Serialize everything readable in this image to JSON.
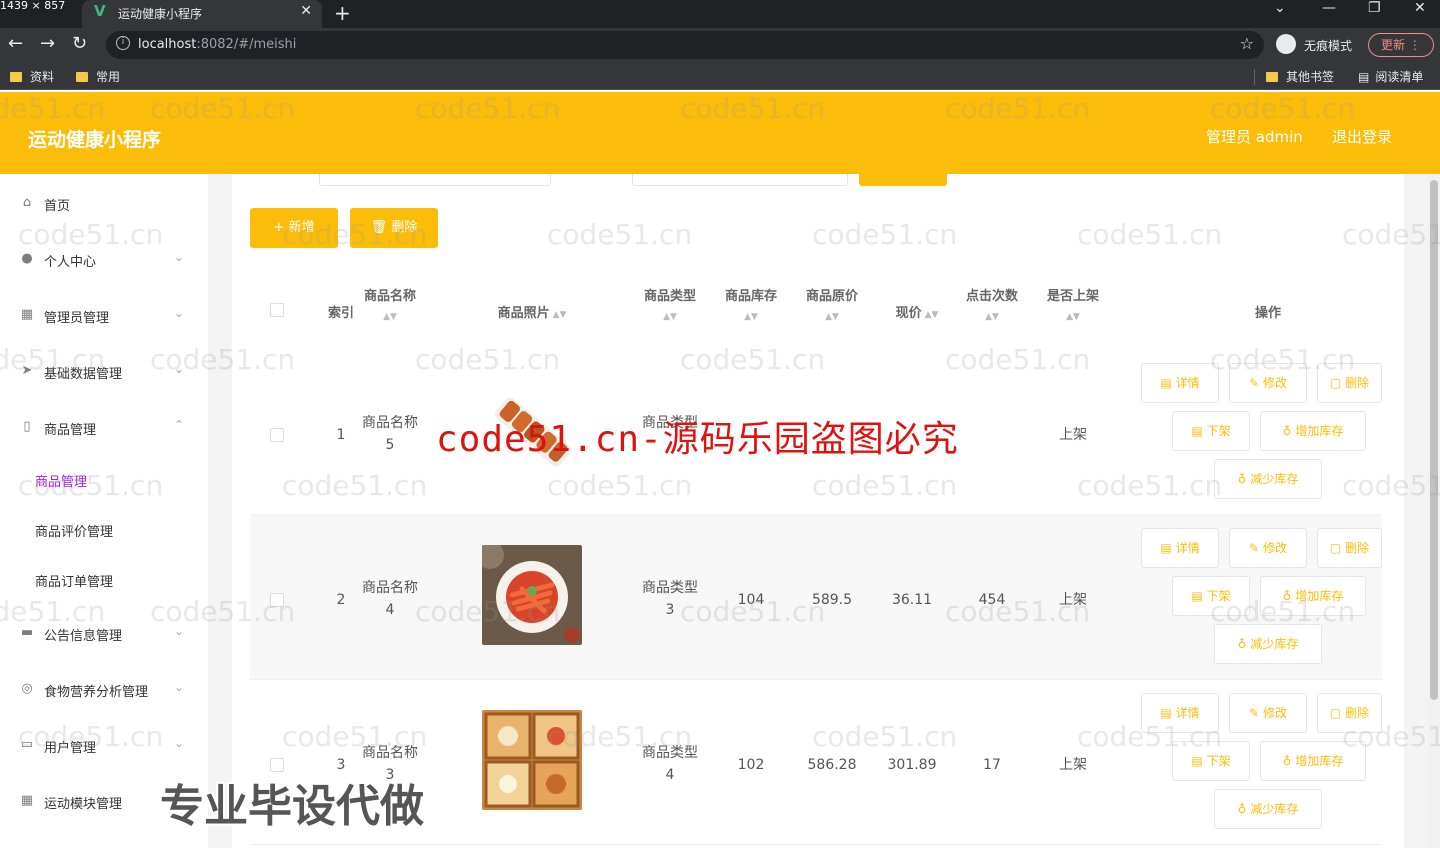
{
  "browser": {
    "dims_badge": "1439 × 857",
    "tab_title": "运动健康小程序",
    "url_host": "localhost",
    "url_rest": ":8082/#/meishi",
    "incognito_label": "无痕模式",
    "update_label": "更新",
    "bookmarks_left": [
      "资料",
      "常用"
    ],
    "bookmarks_right": [
      "其他书签",
      "阅读清单"
    ]
  },
  "header": {
    "app_title": "运动健康小程序",
    "admin_label": "管理员 admin",
    "logout_label": "退出登录"
  },
  "sidebar": {
    "items": [
      {
        "label": "首页",
        "icon": "home-icon"
      },
      {
        "label": "个人中心",
        "icon": "user-icon"
      },
      {
        "label": "管理员管理",
        "icon": "grid-icon"
      },
      {
        "label": "基础数据管理",
        "icon": "send-icon"
      },
      {
        "label": "商品管理",
        "icon": "phone-icon"
      },
      {
        "label": "公告信息管理",
        "icon": "briefcase-icon"
      },
      {
        "label": "食物营养分析管理",
        "icon": "compass-icon"
      },
      {
        "label": "用户管理",
        "icon": "chat-icon"
      },
      {
        "label": "运动模块管理",
        "icon": "apps-icon"
      }
    ],
    "sub_items": [
      "商品管理",
      "商品评价管理",
      "商品订单管理"
    ]
  },
  "toolbar": {
    "add_label": "+ 新增",
    "delete_label": "删除"
  },
  "table": {
    "headers": {
      "index": "索引",
      "name": "商品名称",
      "photo": "商品照片",
      "type": "商品类型",
      "stock": "商品库存",
      "orig_price": "商品原价",
      "price": "现价",
      "clicks": "点击次数",
      "on_sale": "是否上架",
      "ops": "操作"
    },
    "rows": [
      {
        "index": "1",
        "name": "商品名称",
        "name_num": "5",
        "type": "商品类型",
        "type_num": "",
        "stock": "",
        "orig_price": "",
        "price": "",
        "clicks": "",
        "on_sale": "上架"
      },
      {
        "index": "2",
        "name": "商品名称",
        "name_num": "4",
        "type": "商品类型",
        "type_num": "3",
        "stock": "104",
        "orig_price": "589.5",
        "price": "36.11",
        "clicks": "454",
        "on_sale": "上架"
      },
      {
        "index": "3",
        "name": "商品名称",
        "name_num": "3",
        "type": "商品类型",
        "type_num": "4",
        "stock": "102",
        "orig_price": "586.28",
        "price": "301.89",
        "clicks": "17",
        "on_sale": "上架"
      }
    ],
    "ops": {
      "detail": "详情",
      "edit": "修改",
      "delete": "删除",
      "off_shelf": "下架",
      "add_stock": "增加库存",
      "reduce_stock": "减少库存"
    }
  },
  "overlays": {
    "watermark": "code51.cn",
    "red_text": "code51.cn-源码乐园盗图必究",
    "bottom_text": "专业毕设代做"
  },
  "colors": {
    "accent": "#fcbd0a",
    "active_sub": "#a020f0",
    "overlay_red": "#e0120f"
  }
}
